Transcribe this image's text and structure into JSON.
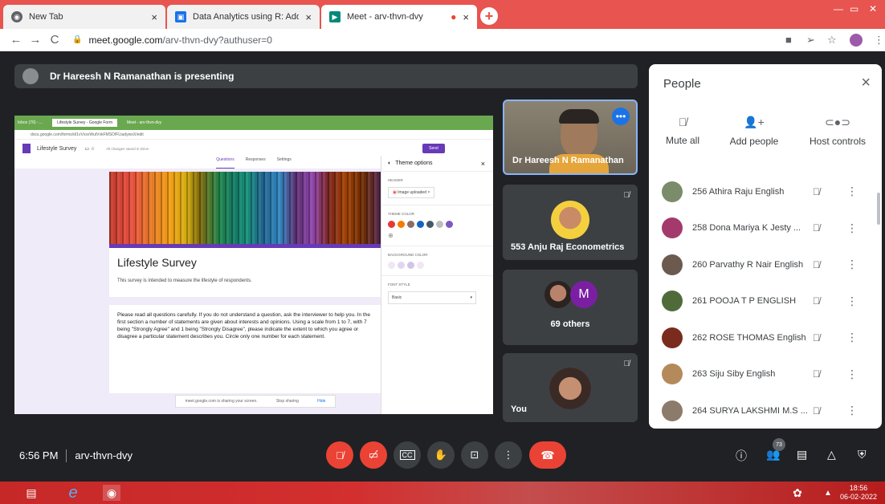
{
  "browser": {
    "tabs": [
      {
        "title": "New Tab",
        "close": "×"
      },
      {
        "title": "Data Analytics using R: Add on C",
        "close": "×"
      },
      {
        "title": "Meet - arv-thvn-dvy",
        "close": "×"
      }
    ],
    "new_tab": "+",
    "url_host": "meet.google.com",
    "url_path": "/arv-thvn-dvy?authuser=0"
  },
  "presenting_banner": "Dr Hareesh N Ramanathan is presenting",
  "shared_screen": {
    "form_tabs": [
      "Inbox (76) - ...",
      "Lifestyle Survey - Google Form",
      "Meet - arv-thvn-dvy"
    ],
    "form_url": "docs.google.com/forms/d/1vVxsvWutVvkFMSOfFLtadywoX/edit",
    "doc_title": "Lifestyle Survey",
    "saved_status": "All changes saved in Drive",
    "send_label": "Send",
    "nav": [
      "Questions",
      "Responses",
      "Settings"
    ],
    "form_title": "Lifestyle Survey",
    "form_description": "This survey is intended to measure the lifestyle of respondents.",
    "instructions": "Please read all questions carefully. If you do not understand a question, ask the interviewer to help you. In the first section a number of statements are given about interests and opinions. Using a scale from 1 to 7, with 7 being \"Strongly Agree\" and 1 being \"Strongly Disagree\", please indicate the extent to which you agree or disagree a particular statement describes you. Circle only one number for each statement.",
    "share_notice": "meet.google.com is sharing your screen.",
    "stop_sharing": "Stop sharing",
    "hide": "Hide",
    "theme": {
      "title": "Theme options",
      "header_label": "HEADER",
      "image_chip": "Image uploaded",
      "theme_color_label": "THEME COLOR",
      "theme_colors": [
        "#e53935",
        "#f57c00",
        "#8d6e63",
        "#1565c0",
        "#455a64",
        "#bdbdbd",
        "#7e57c2"
      ],
      "bg_color_label": "BACKGROUND COLOR",
      "bg_colors": [
        "#ede7f6",
        "#e1d5f0",
        "#d1c4e9",
        "#f3e5f5"
      ],
      "font_style_label": "FONT STYLE",
      "font_style_value": "Basic"
    }
  },
  "tiles": {
    "presenter_name": "Dr Hareesh N Ramanathan",
    "more_label": "•••",
    "tile2_name": "553 Anju Raj Econometrics",
    "tile3_label": "69 others",
    "tile3_avatar_letter": "M",
    "tile4_name": "You"
  },
  "people": {
    "title": "People",
    "controls": [
      {
        "label": "Mute all"
      },
      {
        "label": "Add people"
      },
      {
        "label": "Host controls"
      }
    ],
    "participants": [
      {
        "name": "256 Athira Raju English",
        "color": "#7a8c6a"
      },
      {
        "name": "258 Dona Mariya K Jesty ...",
        "color": "#a33a6b"
      },
      {
        "name": "260 Parvathy R Nair English",
        "color": "#6d5a4f"
      },
      {
        "name": "261 POOJA T P ENGLISH",
        "color": "#4f6b3a"
      },
      {
        "name": "262 ROSE THOMAS English",
        "color": "#7a2b1d"
      },
      {
        "name": "263 Siju Siby English",
        "color": "#b58a5a"
      },
      {
        "name": "264 SURYA LAKSHMI M.S ...",
        "color": "#8c7a6b"
      }
    ]
  },
  "bottom_bar": {
    "time": "6:56 PM",
    "meeting_code": "arv-thvn-dvy",
    "participant_count": "73"
  },
  "taskbar": {
    "time": "18:56",
    "date": "06-02-2022"
  }
}
